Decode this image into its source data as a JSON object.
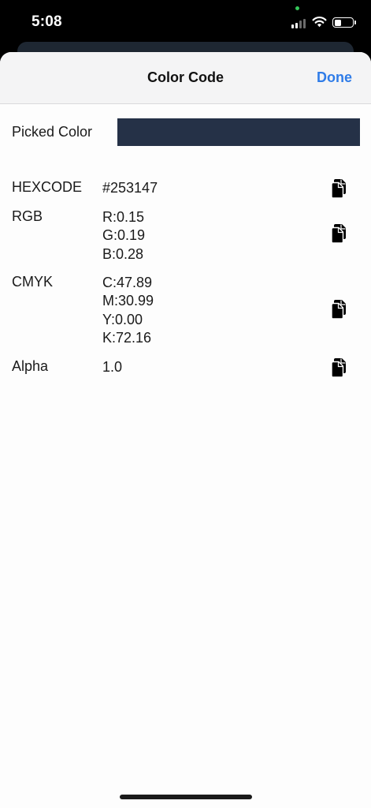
{
  "status_bar": {
    "time": "5:08",
    "camera_indicator_color": "#35c759",
    "battery_level": 0.35
  },
  "nav": {
    "title": "Color Code",
    "done_label": "Done",
    "accent_color": "#2f7ce8"
  },
  "picked": {
    "label": "Picked Color",
    "color": "#253147"
  },
  "rows": {
    "hexcode": {
      "label": "HEXCODE",
      "values": [
        "#253147"
      ]
    },
    "rgb": {
      "label": "RGB",
      "values": [
        "R:0.15",
        "G:0.19",
        "B:0.28"
      ]
    },
    "cmyk": {
      "label": "CMYK",
      "values": [
        "C:47.89",
        "M:30.99",
        "Y:0.00",
        "K:72.16"
      ]
    },
    "alpha": {
      "label": "Alpha",
      "values": [
        "1.0"
      ]
    }
  },
  "icons": {
    "copy": "copy-icon"
  }
}
